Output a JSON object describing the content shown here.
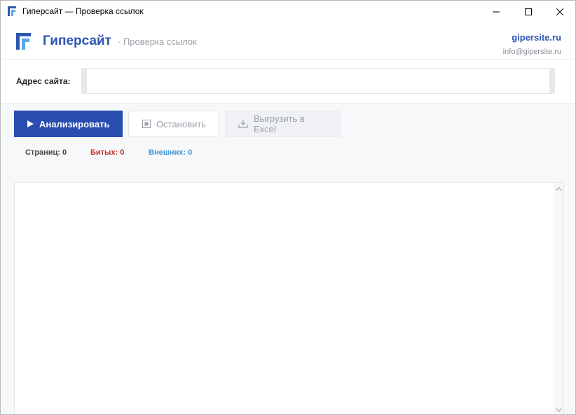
{
  "window": {
    "title": "Гиперсайт — Проверка ссылок",
    "controls": {
      "minimize": "—",
      "maximize": "☐",
      "close": "✕"
    }
  },
  "header": {
    "brand_name": "Гиперсайт",
    "subtitle": "· Проверка ссылок",
    "site": "gipersite.ru",
    "email": "info@gipersite.ru"
  },
  "address": {
    "label": "Адрес сайта:",
    "value": "",
    "placeholder": ""
  },
  "toolbar": {
    "analyze_label": "Анализировать",
    "stop_label": "Остановить",
    "export_label": "Выгрузить в Excel"
  },
  "stats": {
    "pages": "Страниц: 0",
    "broken": "Битых: 0",
    "external": "Внешних: 0"
  },
  "icons": {
    "app": "logo-icon",
    "analyze": "play-icon",
    "stop": "stop-icon",
    "export": "download-tray-icon",
    "scroll_up": "chevron-up-icon",
    "scroll_down": "chevron-down-icon"
  },
  "colors": {
    "brand": "#2d56b3",
    "primary_button": "#2a4db0",
    "broken": "#c42a2a",
    "external": "#3b95d6"
  }
}
